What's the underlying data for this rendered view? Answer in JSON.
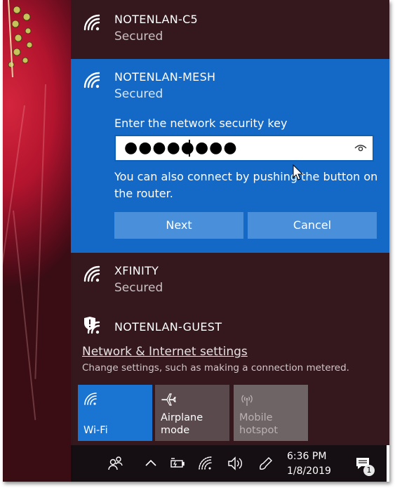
{
  "networks": {
    "c5": {
      "name": "NOTENLAN-C5",
      "status": "Secured"
    },
    "mesh": {
      "name": "NOTENLAN-MESH",
      "status": "Secured",
      "prompt": "Enter the network security key",
      "key_value": "●●●●●●●●",
      "hint": "You can also connect by pushing the button on the router.",
      "next_label": "Next",
      "cancel_label": "Cancel"
    },
    "xfinity": {
      "name": "XFINITY",
      "status": "Secured"
    },
    "guest": {
      "name": "NOTENLAN-GUEST"
    }
  },
  "settings": {
    "link_label": "Network & Internet settings",
    "description": "Change settings, such as making a connection metered."
  },
  "quick_actions": [
    {
      "label": "Wi-Fi",
      "icon": "wifi-icon",
      "active": true,
      "color": "#1a75d2"
    },
    {
      "label": "Airplane mode",
      "icon": "airplane-icon",
      "active": false,
      "color": "#5a4a4d"
    },
    {
      "label": "Mobile hotspot",
      "icon": "hotspot-icon",
      "active": false,
      "disabled": true,
      "color": "#6e6466"
    }
  ],
  "taskbar": {
    "time": "6:36 PM",
    "date": "1/8/2019",
    "notification_count": "1",
    "icons": [
      "people-icon",
      "chevron-up-icon",
      "battery-icon",
      "wifi-icon",
      "volume-icon",
      "pen-icon",
      "action-center-icon"
    ]
  },
  "colors": {
    "accent": "#1468c6",
    "flyout_bg": "#34181e",
    "button_bg": "#4a8fd9"
  }
}
